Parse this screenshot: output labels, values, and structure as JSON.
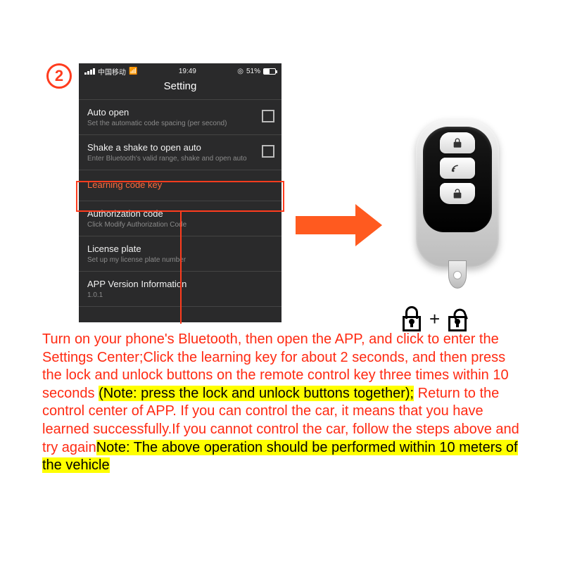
{
  "step": "2",
  "phone": {
    "status": {
      "carrier": "中国移动",
      "time": "19:49",
      "battery_pct": "51%"
    },
    "title": "Setting",
    "items": [
      {
        "title": "Auto open",
        "sub": "Set the automatic code spacing (per second)",
        "checkbox": true
      },
      {
        "title": "Shake a shake to open auto",
        "sub": "Enter Bluetooth's valid range, shake and open auto",
        "checkbox": true
      },
      {
        "title": "Learning code key",
        "sub": "",
        "checkbox": false,
        "highlight": true
      },
      {
        "title": "Authorization code",
        "sub": "Click Modify Authorization Code",
        "checkbox": false
      },
      {
        "title": "License plate",
        "sub": "Set up my license plate number",
        "checkbox": false
      },
      {
        "title": "APP Version Information",
        "sub": "1.0.1",
        "checkbox": false
      }
    ]
  },
  "lock_combo_plus": "+",
  "instructions": {
    "t1": "Turn on your phone's Bluetooth, then open the APP, and click to enter the Settings Center;Click the learning key for about 2 seconds, and then press the lock and unlock buttons on the remote control key three times within 10 seconds ",
    "h1": "(Note: press the lock and unlock buttons together);",
    "t2": "Return to the control center of APP. If you can control the car, it means that you have learned successfully.If you cannot control the car, follow the steps above and try again",
    "h2": "Note: The above operation should be performed within 10 meters of the vehicle"
  }
}
